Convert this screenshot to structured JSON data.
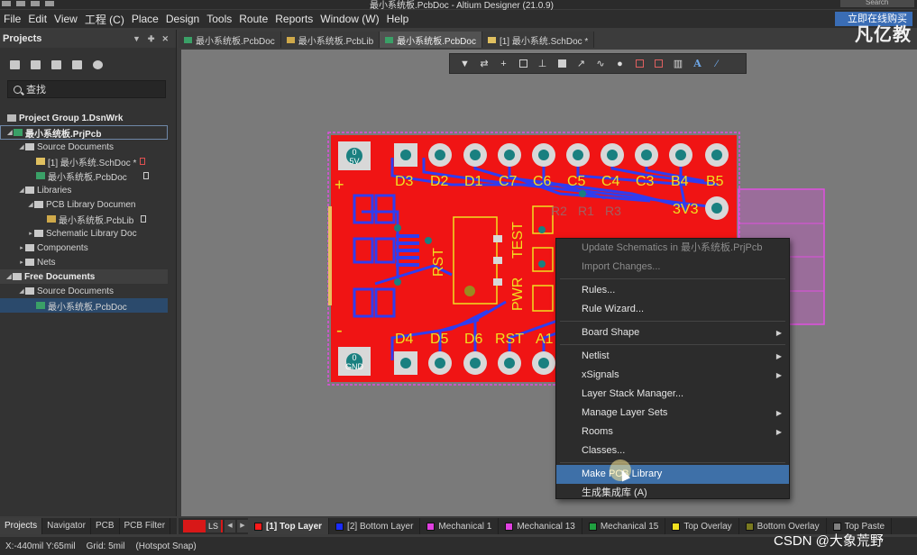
{
  "window": {
    "title": "最小系统板.PcbDoc - Altium Designer (21.0.9)",
    "search_placeholder": "Search",
    "buy_button": "立即在线购买",
    "watermark_top": "凡亿教"
  },
  "menu": [
    "File",
    "Edit",
    "View",
    "工程 (C)",
    "Place",
    "Design",
    "Tools",
    "Route",
    "Reports",
    "Window (W)",
    "Help"
  ],
  "projects_panel": {
    "title": "Projects",
    "search": "查找",
    "tree": [
      {
        "label": "Project Group 1.DsnWrk",
        "icon": "group-icon",
        "bold": true
      },
      {
        "label": "最小系统板.PrjPcb",
        "icon": "pcb-project-icon",
        "bold": true
      },
      {
        "label": "Source Documents",
        "icon": "folder-icon"
      },
      {
        "label": "[1] 最小系统.SchDoc *",
        "icon": "schdoc-icon"
      },
      {
        "label": "最小系统板.PcbDoc",
        "icon": "pcbdoc-icon"
      },
      {
        "label": "Libraries",
        "icon": "folder-icon"
      },
      {
        "label": "PCB Library Documen",
        "icon": "folder-icon"
      },
      {
        "label": "最小系统板.PcbLib",
        "icon": "pcblib-icon"
      },
      {
        "label": "Schematic Library Doc",
        "icon": "folder-icon"
      },
      {
        "label": "Components",
        "icon": "folder-icon"
      },
      {
        "label": "Nets",
        "icon": "folder-icon"
      },
      {
        "label": "Free Documents",
        "icon": "folder-icon",
        "bold": true
      },
      {
        "label": "Source Documents",
        "icon": "folder-icon"
      },
      {
        "label": "最小系统板.PcbDoc",
        "icon": "pcbdoc-icon"
      }
    ]
  },
  "doc_tabs": [
    {
      "label": "最小系统板.PcbDoc",
      "active": false
    },
    {
      "label": "最小系统板.PcbLib",
      "active": false
    },
    {
      "label": "最小系统板.PcbDoc",
      "active": true
    },
    {
      "label": "[1] 最小系统.SchDoc *",
      "active": false
    }
  ],
  "pcb_labels": {
    "top_row": [
      "D3",
      "D2",
      "D1",
      "C7",
      "C6",
      "C5",
      "C4",
      "C3",
      "B4",
      "B5"
    ],
    "bottom_row": [
      "D4",
      "D5",
      "D6",
      "RST",
      "A1"
    ],
    "side": [
      "3V3",
      "RST",
      "PWR",
      "TEST",
      "R3",
      "R1",
      "R2"
    ],
    "pad_top": [
      "0",
      "5V"
    ],
    "pad_bottom": [
      "0",
      "GND"
    ],
    "plus": "+",
    "minus": "-"
  },
  "context_menu": [
    {
      "label": "Update Schematics in 最小系统板.PrjPcb",
      "disabled": true
    },
    {
      "label": "Import Changes...",
      "disabled": true
    },
    {
      "sep": true
    },
    {
      "label": "Rules..."
    },
    {
      "label": "Rule Wizard..."
    },
    {
      "sep": true
    },
    {
      "label": "Board Shape",
      "submenu": true
    },
    {
      "sep": true
    },
    {
      "label": "Netlist",
      "submenu": true
    },
    {
      "label": "xSignals",
      "submenu": true
    },
    {
      "label": "Layer Stack Manager..."
    },
    {
      "label": "Manage Layer Sets",
      "submenu": true
    },
    {
      "label": "Rooms",
      "submenu": true
    },
    {
      "label": "Classes..."
    },
    {
      "sep": true
    },
    {
      "label": "Make PCB Library",
      "selected": true
    },
    {
      "label": "生成集成库 (A)"
    }
  ],
  "panel_tabs": [
    "Projects",
    "Navigator",
    "PCB",
    "PCB Filter"
  ],
  "layers": [
    {
      "label": "[1] Top Layer",
      "color": "#ff1a1a",
      "active": true
    },
    {
      "label": "[2] Bottom Layer",
      "color": "#1a2cff"
    },
    {
      "label": "Mechanical 1",
      "color": "#e040e0"
    },
    {
      "label": "Mechanical 13",
      "color": "#e040e0"
    },
    {
      "label": "Mechanical 15",
      "color": "#20a040"
    },
    {
      "label": "Top Overlay",
      "color": "#f0e020"
    },
    {
      "label": "Bottom Overlay",
      "color": "#7a7a20"
    },
    {
      "label": "Top Paste",
      "color": "#808080"
    }
  ],
  "layer_bar": {
    "ls": "LS"
  },
  "status": {
    "coords": "X:-440mil Y:65mil",
    "grid": "Grid: 5mil",
    "snap": "(Hotspot Snap)"
  },
  "watermark_bottom": "CSDN @大象荒野",
  "side_mark": "D"
}
